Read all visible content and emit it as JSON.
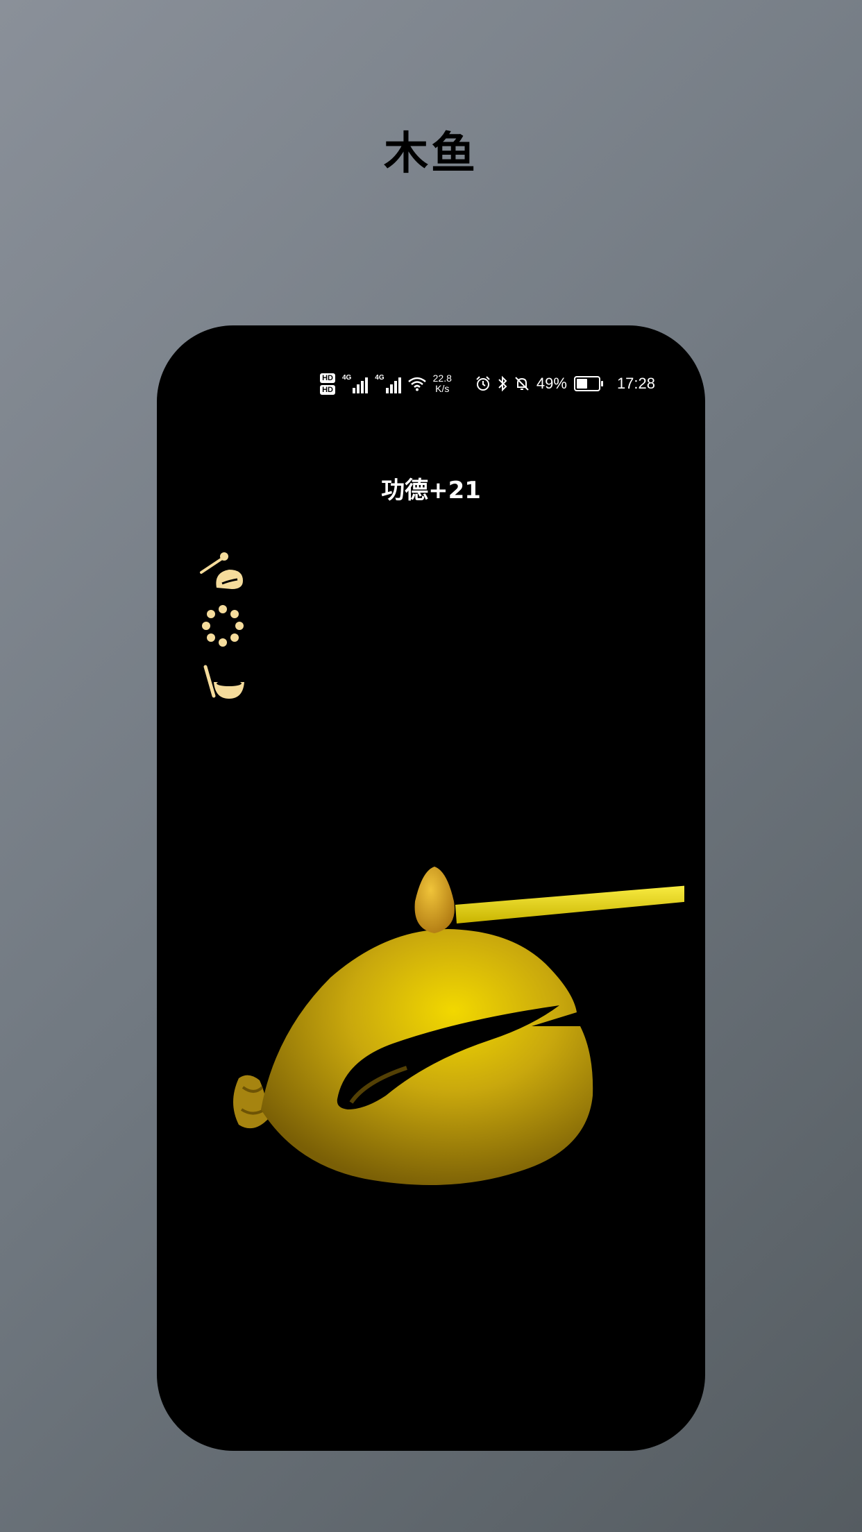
{
  "promo": {
    "title": "木鱼"
  },
  "statusbar": {
    "hd1": "HD",
    "hd2": "HD",
    "sim1_gen": "4G",
    "sim2_gen": "4G",
    "speed_value": "22.8",
    "speed_unit": "K/s",
    "battery": "49%",
    "time": "17:28"
  },
  "merit": {
    "text": "功德+21"
  },
  "sidebar": {
    "items": [
      {
        "icon": "woodfish-mallet-icon"
      },
      {
        "icon": "prayer-beads-icon"
      },
      {
        "icon": "singing-bowl-icon"
      }
    ]
  },
  "colors": {
    "accent": "#f5dc9c",
    "wood": "#d4b20f",
    "screen": "#000000"
  }
}
